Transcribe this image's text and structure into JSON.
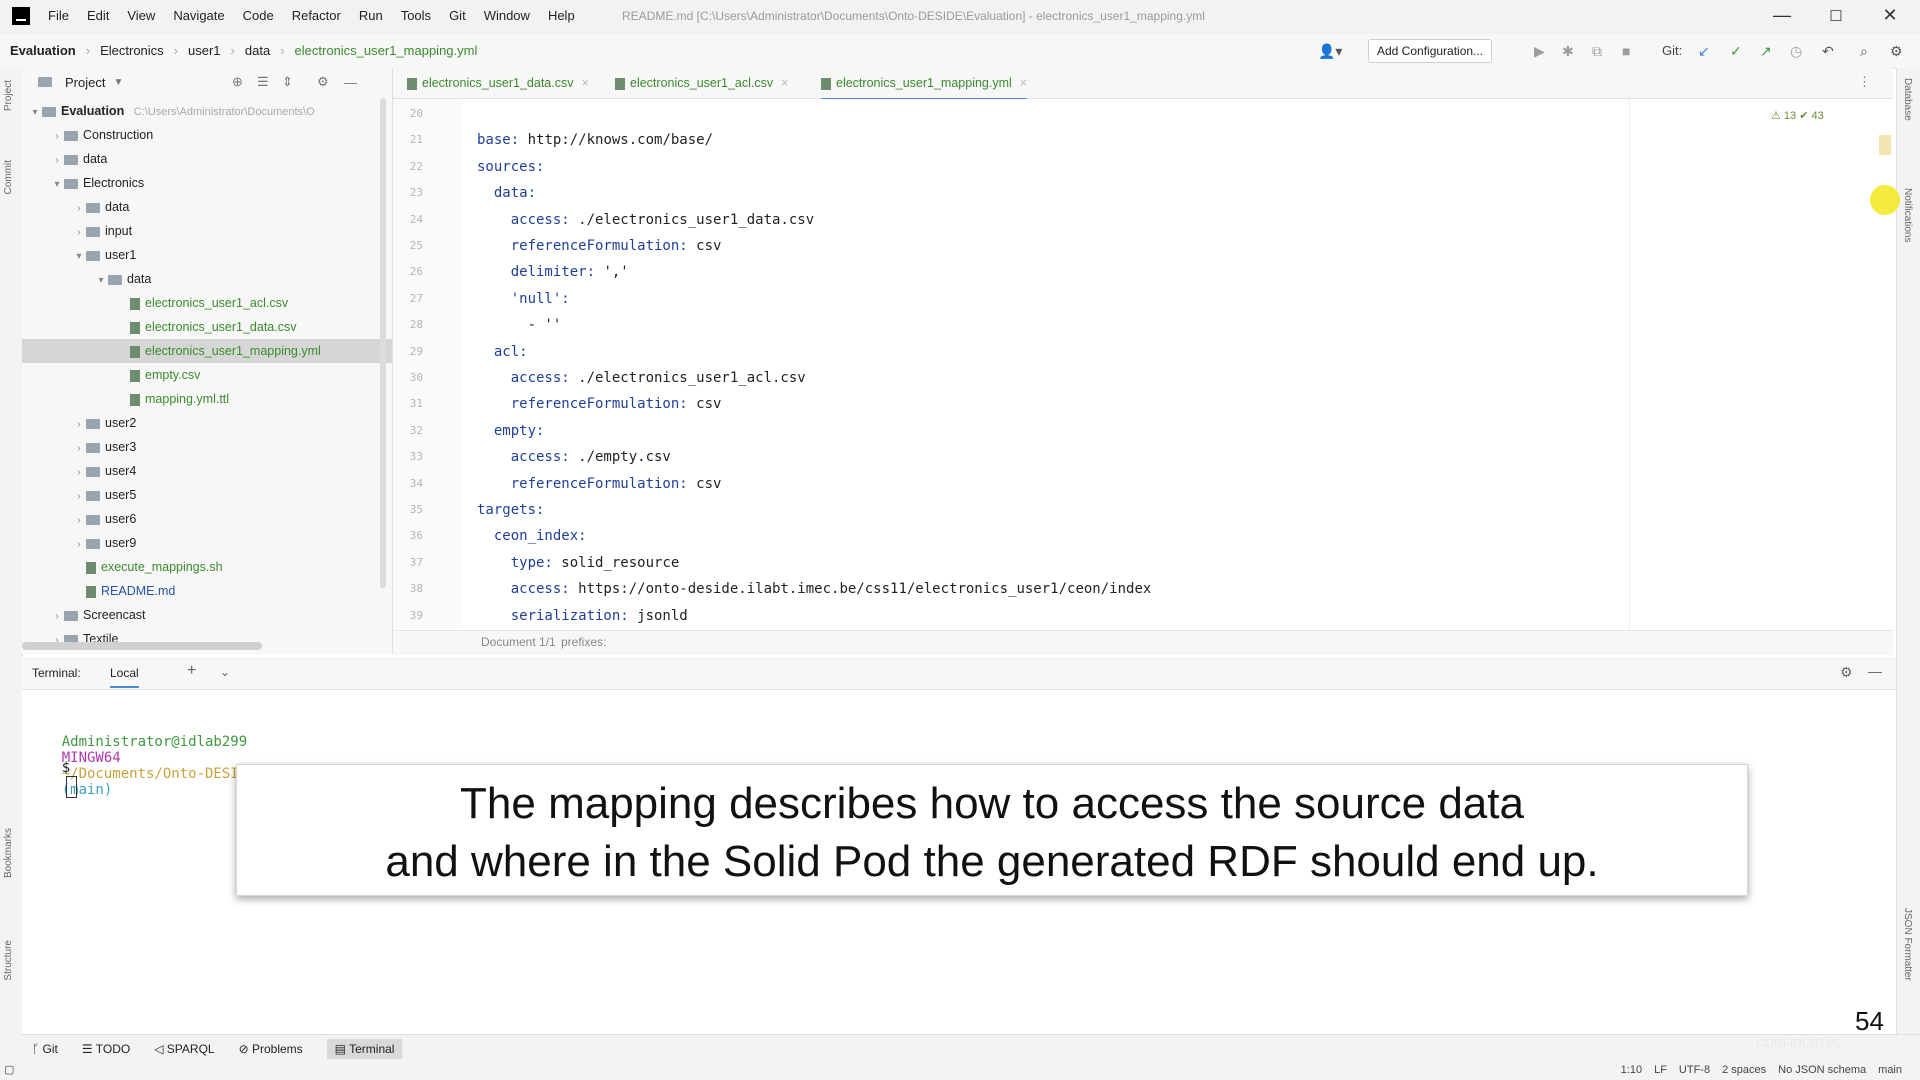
{
  "window": {
    "menu": [
      "File",
      "Edit",
      "View",
      "Navigate",
      "Code",
      "Refactor",
      "Run",
      "Tools",
      "Git",
      "Window",
      "Help"
    ],
    "title": "README.md [C:\\Users\\Administrator\\Documents\\Onto-DESIDE\\Evaluation] - electronics_user1_mapping.yml",
    "minimize": "—",
    "maximize": "☐",
    "close": "✕"
  },
  "navbar": {
    "crumbs": [
      "Evaluation",
      "Electronics",
      "user1",
      "data",
      "electronics_user1_mapping.yml"
    ],
    "add_configuration": "Add Configuration...",
    "git_label": "Git:"
  },
  "project": {
    "header": "Project",
    "root": "Evaluation",
    "root_path": "C:\\Users\\Administrator\\Documents\\O",
    "items": [
      {
        "label": "Construction",
        "type": "folder",
        "level": 1
      },
      {
        "label": "data",
        "type": "folder",
        "level": 1
      },
      {
        "label": "Electronics",
        "type": "folder",
        "level": 1
      },
      {
        "label": "data",
        "type": "folder",
        "level": 2
      },
      {
        "label": "input",
        "type": "folder",
        "level": 2
      },
      {
        "label": "user1",
        "type": "folder",
        "level": 2
      },
      {
        "label": "data",
        "type": "folder",
        "level": 3
      },
      {
        "label": "electronics_user1_acl.csv",
        "type": "file",
        "level": 4
      },
      {
        "label": "electronics_user1_data.csv",
        "type": "file",
        "level": 4
      },
      {
        "label": "electronics_user1_mapping.yml",
        "type": "file",
        "level": 4
      },
      {
        "label": "empty.csv",
        "type": "file",
        "level": 4
      },
      {
        "label": "mapping.yml.ttl",
        "type": "file",
        "level": 4
      },
      {
        "label": "user2",
        "type": "folder",
        "level": 2
      },
      {
        "label": "user3",
        "type": "folder",
        "level": 2
      },
      {
        "label": "user4",
        "type": "folder",
        "level": 2
      },
      {
        "label": "user5",
        "type": "folder",
        "level": 2
      },
      {
        "label": "user6",
        "type": "folder",
        "level": 2
      },
      {
        "label": "user9",
        "type": "folder",
        "level": 2
      },
      {
        "label": "execute_mappings.sh",
        "type": "file",
        "level": 2
      },
      {
        "label": "README.md",
        "type": "file",
        "level": 2
      },
      {
        "label": "Screencast",
        "type": "folder",
        "level": 1
      },
      {
        "label": "Textile",
        "type": "folder",
        "level": 1
      }
    ]
  },
  "tabs": [
    {
      "label": "electronics_user1_data.csv",
      "active": false
    },
    {
      "label": "electronics_user1_acl.csv",
      "active": false
    },
    {
      "label": "electronics_user1_mapping.yml",
      "active": true
    }
  ],
  "editor": {
    "inspections": "⚠ 13  ✔ 43",
    "lines": [
      {
        "num": "20",
        "key": "",
        "val": ""
      },
      {
        "num": "21",
        "key": "base:",
        "val": " http://knows.com/base/"
      },
      {
        "num": "22",
        "key": "sources:",
        "val": ""
      },
      {
        "num": "23",
        "key": "  data:",
        "val": ""
      },
      {
        "num": "24",
        "key": "    access:",
        "val": " ./electronics_user1_data.csv"
      },
      {
        "num": "25",
        "key": "    referenceFormulation:",
        "val": " csv"
      },
      {
        "num": "26",
        "key": "    delimiter:",
        "val": " ','"
      },
      {
        "num": "27",
        "key": "    'null':",
        "val": ""
      },
      {
        "num": "28",
        "key": "",
        "val": "      - ''"
      },
      {
        "num": "29",
        "key": "  acl:",
        "val": ""
      },
      {
        "num": "30",
        "key": "    access:",
        "val": " ./electronics_user1_acl.csv"
      },
      {
        "num": "31",
        "key": "    referenceFormulation:",
        "val": " csv"
      },
      {
        "num": "32",
        "key": "  empty:",
        "val": ""
      },
      {
        "num": "33",
        "key": "    access:",
        "val": " ./empty.csv"
      },
      {
        "num": "34",
        "key": "    referenceFormulation:",
        "val": " csv"
      },
      {
        "num": "35",
        "key": "targets:",
        "val": ""
      },
      {
        "num": "36",
        "key": "  ceon_index:",
        "val": ""
      },
      {
        "num": "37",
        "key": "    type:",
        "val": " solid_resource"
      },
      {
        "num": "38",
        "key": "    access:",
        "val": " https://onto-deside.ilabt.imec.be/css11/electronics_user1/ceon/index"
      },
      {
        "num": "39",
        "key": "    serialization:",
        "val": " jsonld"
      }
    ],
    "breadcrumb": [
      "Document 1/1",
      "prefixes:"
    ]
  },
  "terminal": {
    "tab_label": "Terminal:",
    "session": "Local",
    "prompt_user": "Administrator@idlab299",
    "prompt_shell": "MINGW64",
    "prompt_path": "~/Documents/Onto-DESIDE/Evaluation/Electronics/user1",
    "prompt_branch": "(main)",
    "prompt_symbol": "$"
  },
  "caption": {
    "line1": "The mapping describes how to access the source data",
    "line2": "and where in the Solid Pod the generated RDF should end up."
  },
  "toolwindows": [
    "Git",
    "TODO",
    "SPARQL",
    "Problems",
    "Terminal"
  ],
  "status": [
    "1:10",
    "LF",
    "UTF-8",
    "2 spaces",
    "No JSON schema",
    "main"
  ],
  "slide_number": "54",
  "watermark": "CONFIDENTIAL",
  "left_strip": [
    "Project",
    "Commit",
    "Bookmarks",
    "Structure"
  ],
  "right_strip": [
    "Database",
    "Notifications",
    "JSON Formatter"
  ]
}
